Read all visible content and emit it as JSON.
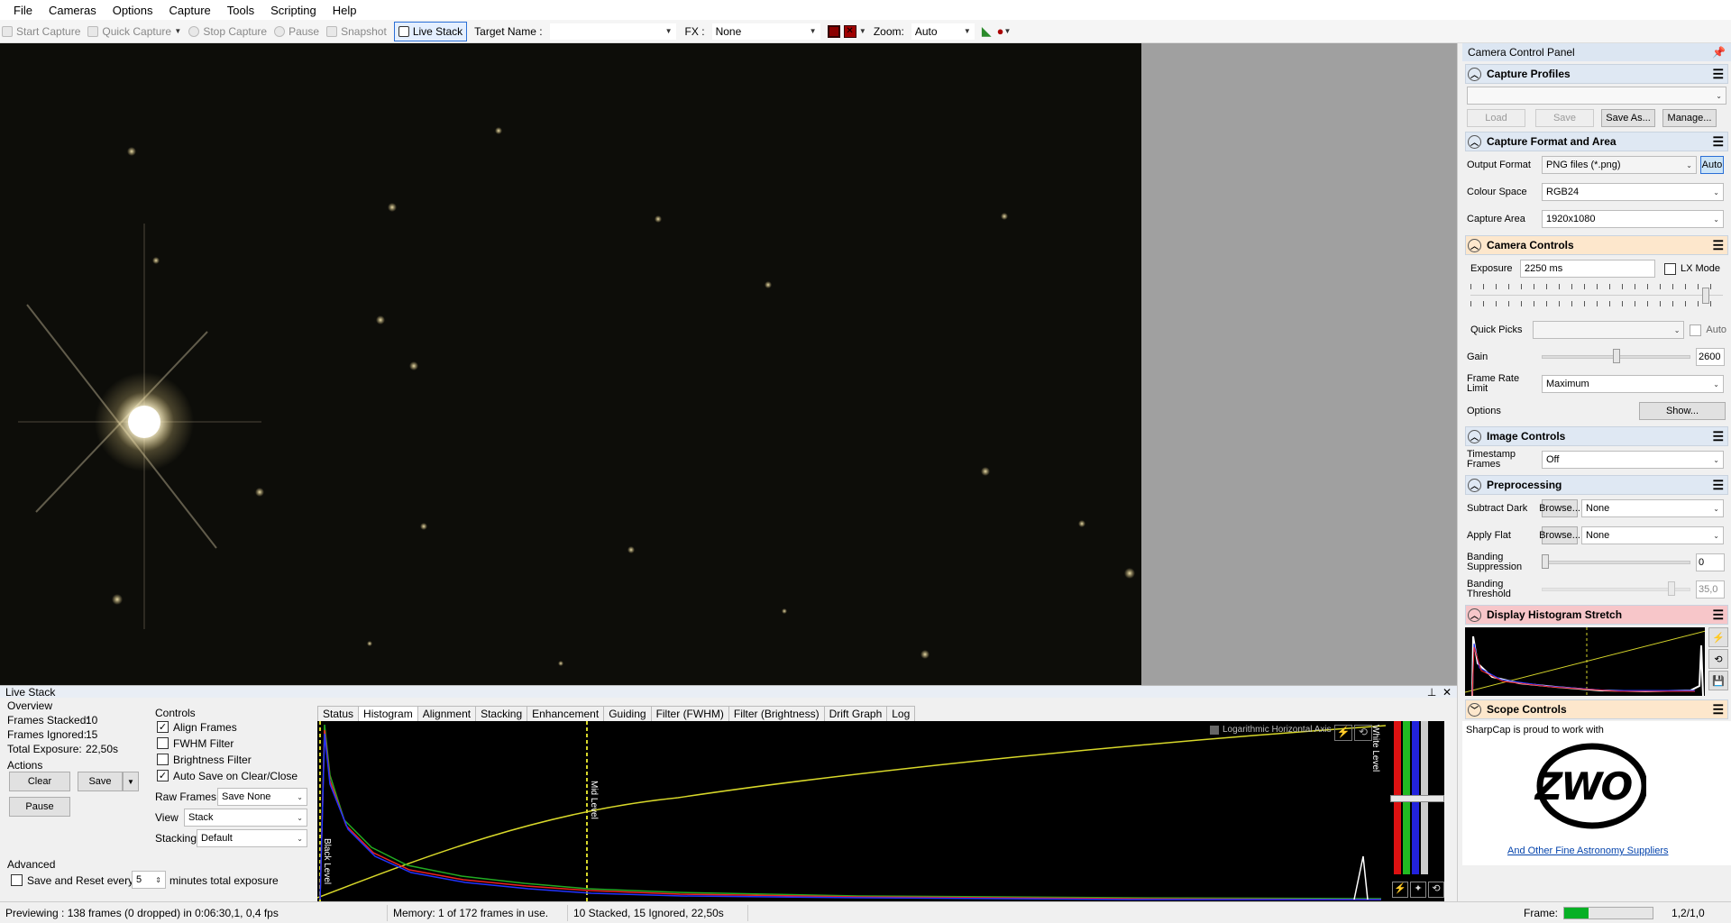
{
  "menu": [
    "File",
    "Cameras",
    "Options",
    "Capture",
    "Tools",
    "Scripting",
    "Help"
  ],
  "toolbar": {
    "start_capture": "Start Capture",
    "quick_capture": "Quick Capture",
    "stop_capture": "Stop Capture",
    "pause": "Pause",
    "snapshot": "Snapshot",
    "live_stack": "Live Stack",
    "target_label": "Target Name :",
    "target_value": "",
    "fx_label": "FX :",
    "fx_value": "None",
    "zoom_label": "Zoom:",
    "zoom_value": "Auto"
  },
  "panel": {
    "title": "Camera Control Panel",
    "capture_profiles": {
      "header": "Capture Profiles",
      "profile_value": "",
      "load": "Load",
      "save": "Save",
      "save_as": "Save As...",
      "manage": "Manage..."
    },
    "format": {
      "header": "Capture Format and Area",
      "output_format_label": "Output Format",
      "output_format_value": "PNG files (*.png)",
      "auto": "Auto",
      "colour_space_label": "Colour Space",
      "colour_space_value": "RGB24",
      "capture_area_label": "Capture Area",
      "capture_area_value": "1920x1080"
    },
    "camera": {
      "header": "Camera Controls",
      "exposure_label": "Exposure",
      "exposure_value": "2250 ms",
      "lx_mode": "LX Mode",
      "quick_picks_label": "Quick Picks",
      "quick_picks_value": "",
      "auto": "Auto",
      "gain_label": "Gain",
      "gain_value": "2600",
      "gain_level": 0.5,
      "frame_rate_label": "Frame Rate Limit",
      "frame_rate_value": "Maximum",
      "options_label": "Options",
      "show": "Show..."
    },
    "image": {
      "header": "Image Controls",
      "timestamp_label": "Timestamp Frames",
      "timestamp_value": "Off"
    },
    "preprocessing": {
      "header": "Preprocessing",
      "subtract_dark_label": "Subtract Dark",
      "apply_flat_label": "Apply Flat",
      "browse": "Browse...",
      "none": "None",
      "banding_suppression_label": "Banding Suppression",
      "banding_suppression_value": "0",
      "banding_threshold_label": "Banding Threshold",
      "banding_threshold_value": "35,0"
    },
    "stretch": {
      "header": "Display Histogram Stretch"
    },
    "scope": {
      "header": "Scope Controls"
    },
    "sponsor": {
      "text": "SharpCap is proud to work with",
      "logo": "ZWO",
      "link": "And Other Fine Astronomy Suppliers"
    }
  },
  "livestack": {
    "title": "Live Stack",
    "overview": "Overview",
    "frames_stacked_label": "Frames Stacked:",
    "frames_stacked": "10",
    "frames_ignored_label": "Frames Ignored:",
    "frames_ignored": "15",
    "total_exposure_label": "Total Exposure:",
    "total_exposure": "22,50s",
    "actions": "Actions",
    "clear": "Clear",
    "save": "Save",
    "pause": "Pause",
    "advanced": "Advanced",
    "save_reset_label": "Save and Reset every",
    "save_reset_value": "5",
    "save_reset_suffix": "minutes total exposure",
    "controls": "Controls",
    "align_frames": "Align Frames",
    "fwhm_filter": "FWHM Filter",
    "brightness_filter": "Brightness Filter",
    "auto_save": "Auto Save on Clear/Close",
    "raw_frames_label": "Raw Frames",
    "raw_frames_value": "Save None",
    "view_label": "View",
    "view_value": "Stack",
    "stacking_label": "Stacking",
    "stacking_value": "Default",
    "tabs": [
      "Status",
      "Histogram",
      "Alignment",
      "Stacking",
      "Enhancement",
      "Guiding",
      "Filter (FWHM)",
      "Filter (Brightness)",
      "Drift Graph",
      "Log"
    ],
    "log_axis": "Logarithmic Horizontal Axis",
    "black_level": "Black Level",
    "mid_level": "Mid Level",
    "white_level": "White Level"
  },
  "status": {
    "previewing": "Previewing : 138 frames (0 dropped) in 0:06:30,1, 0,4 fps",
    "memory": "Memory: 1 of 172 frames in use.",
    "stacked": "10 Stacked, 15 Ignored, 22,50s",
    "frame_label": "Frame:",
    "frame_value": "1,2/1,0"
  },
  "colors": {
    "accent": "#2a6fd6",
    "viewer_bg": "#0d0d09",
    "stretch_header": "#f7c6c9",
    "camera_header": "#fde7cc"
  }
}
